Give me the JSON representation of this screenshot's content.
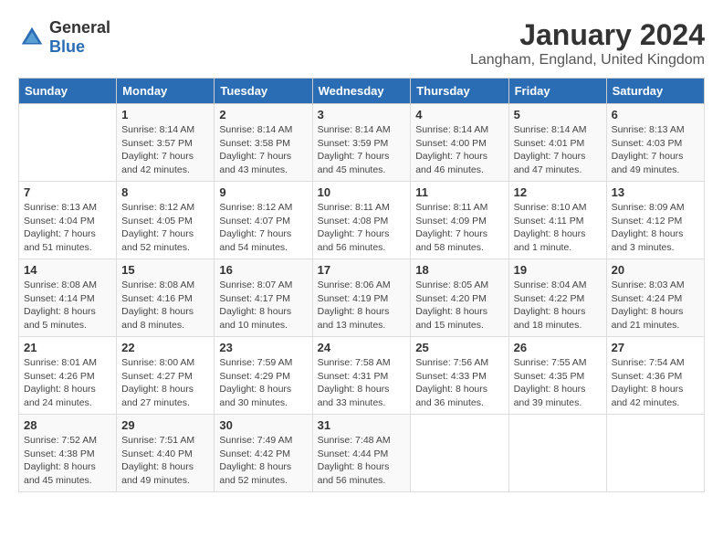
{
  "header": {
    "logo_general": "General",
    "logo_blue": "Blue",
    "month": "January 2024",
    "location": "Langham, England, United Kingdom"
  },
  "days_of_week": [
    "Sunday",
    "Monday",
    "Tuesday",
    "Wednesday",
    "Thursday",
    "Friday",
    "Saturday"
  ],
  "weeks": [
    [
      {
        "day": "",
        "sunrise": "",
        "sunset": "",
        "daylight": ""
      },
      {
        "day": "1",
        "sunrise": "Sunrise: 8:14 AM",
        "sunset": "Sunset: 3:57 PM",
        "daylight": "Daylight: 7 hours and 42 minutes."
      },
      {
        "day": "2",
        "sunrise": "Sunrise: 8:14 AM",
        "sunset": "Sunset: 3:58 PM",
        "daylight": "Daylight: 7 hours and 43 minutes."
      },
      {
        "day": "3",
        "sunrise": "Sunrise: 8:14 AM",
        "sunset": "Sunset: 3:59 PM",
        "daylight": "Daylight: 7 hours and 45 minutes."
      },
      {
        "day": "4",
        "sunrise": "Sunrise: 8:14 AM",
        "sunset": "Sunset: 4:00 PM",
        "daylight": "Daylight: 7 hours and 46 minutes."
      },
      {
        "day": "5",
        "sunrise": "Sunrise: 8:14 AM",
        "sunset": "Sunset: 4:01 PM",
        "daylight": "Daylight: 7 hours and 47 minutes."
      },
      {
        "day": "6",
        "sunrise": "Sunrise: 8:13 AM",
        "sunset": "Sunset: 4:03 PM",
        "daylight": "Daylight: 7 hours and 49 minutes."
      }
    ],
    [
      {
        "day": "7",
        "sunrise": "Sunrise: 8:13 AM",
        "sunset": "Sunset: 4:04 PM",
        "daylight": "Daylight: 7 hours and 51 minutes."
      },
      {
        "day": "8",
        "sunrise": "Sunrise: 8:12 AM",
        "sunset": "Sunset: 4:05 PM",
        "daylight": "Daylight: 7 hours and 52 minutes."
      },
      {
        "day": "9",
        "sunrise": "Sunrise: 8:12 AM",
        "sunset": "Sunset: 4:07 PM",
        "daylight": "Daylight: 7 hours and 54 minutes."
      },
      {
        "day": "10",
        "sunrise": "Sunrise: 8:11 AM",
        "sunset": "Sunset: 4:08 PM",
        "daylight": "Daylight: 7 hours and 56 minutes."
      },
      {
        "day": "11",
        "sunrise": "Sunrise: 8:11 AM",
        "sunset": "Sunset: 4:09 PM",
        "daylight": "Daylight: 7 hours and 58 minutes."
      },
      {
        "day": "12",
        "sunrise": "Sunrise: 8:10 AM",
        "sunset": "Sunset: 4:11 PM",
        "daylight": "Daylight: 8 hours and 1 minute."
      },
      {
        "day": "13",
        "sunrise": "Sunrise: 8:09 AM",
        "sunset": "Sunset: 4:12 PM",
        "daylight": "Daylight: 8 hours and 3 minutes."
      }
    ],
    [
      {
        "day": "14",
        "sunrise": "Sunrise: 8:08 AM",
        "sunset": "Sunset: 4:14 PM",
        "daylight": "Daylight: 8 hours and 5 minutes."
      },
      {
        "day": "15",
        "sunrise": "Sunrise: 8:08 AM",
        "sunset": "Sunset: 4:16 PM",
        "daylight": "Daylight: 8 hours and 8 minutes."
      },
      {
        "day": "16",
        "sunrise": "Sunrise: 8:07 AM",
        "sunset": "Sunset: 4:17 PM",
        "daylight": "Daylight: 8 hours and 10 minutes."
      },
      {
        "day": "17",
        "sunrise": "Sunrise: 8:06 AM",
        "sunset": "Sunset: 4:19 PM",
        "daylight": "Daylight: 8 hours and 13 minutes."
      },
      {
        "day": "18",
        "sunrise": "Sunrise: 8:05 AM",
        "sunset": "Sunset: 4:20 PM",
        "daylight": "Daylight: 8 hours and 15 minutes."
      },
      {
        "day": "19",
        "sunrise": "Sunrise: 8:04 AM",
        "sunset": "Sunset: 4:22 PM",
        "daylight": "Daylight: 8 hours and 18 minutes."
      },
      {
        "day": "20",
        "sunrise": "Sunrise: 8:03 AM",
        "sunset": "Sunset: 4:24 PM",
        "daylight": "Daylight: 8 hours and 21 minutes."
      }
    ],
    [
      {
        "day": "21",
        "sunrise": "Sunrise: 8:01 AM",
        "sunset": "Sunset: 4:26 PM",
        "daylight": "Daylight: 8 hours and 24 minutes."
      },
      {
        "day": "22",
        "sunrise": "Sunrise: 8:00 AM",
        "sunset": "Sunset: 4:27 PM",
        "daylight": "Daylight: 8 hours and 27 minutes."
      },
      {
        "day": "23",
        "sunrise": "Sunrise: 7:59 AM",
        "sunset": "Sunset: 4:29 PM",
        "daylight": "Daylight: 8 hours and 30 minutes."
      },
      {
        "day": "24",
        "sunrise": "Sunrise: 7:58 AM",
        "sunset": "Sunset: 4:31 PM",
        "daylight": "Daylight: 8 hours and 33 minutes."
      },
      {
        "day": "25",
        "sunrise": "Sunrise: 7:56 AM",
        "sunset": "Sunset: 4:33 PM",
        "daylight": "Daylight: 8 hours and 36 minutes."
      },
      {
        "day": "26",
        "sunrise": "Sunrise: 7:55 AM",
        "sunset": "Sunset: 4:35 PM",
        "daylight": "Daylight: 8 hours and 39 minutes."
      },
      {
        "day": "27",
        "sunrise": "Sunrise: 7:54 AM",
        "sunset": "Sunset: 4:36 PM",
        "daylight": "Daylight: 8 hours and 42 minutes."
      }
    ],
    [
      {
        "day": "28",
        "sunrise": "Sunrise: 7:52 AM",
        "sunset": "Sunset: 4:38 PM",
        "daylight": "Daylight: 8 hours and 45 minutes."
      },
      {
        "day": "29",
        "sunrise": "Sunrise: 7:51 AM",
        "sunset": "Sunset: 4:40 PM",
        "daylight": "Daylight: 8 hours and 49 minutes."
      },
      {
        "day": "30",
        "sunrise": "Sunrise: 7:49 AM",
        "sunset": "Sunset: 4:42 PM",
        "daylight": "Daylight: 8 hours and 52 minutes."
      },
      {
        "day": "31",
        "sunrise": "Sunrise: 7:48 AM",
        "sunset": "Sunset: 4:44 PM",
        "daylight": "Daylight: 8 hours and 56 minutes."
      },
      {
        "day": "",
        "sunrise": "",
        "sunset": "",
        "daylight": ""
      },
      {
        "day": "",
        "sunrise": "",
        "sunset": "",
        "daylight": ""
      },
      {
        "day": "",
        "sunrise": "",
        "sunset": "",
        "daylight": ""
      }
    ]
  ]
}
